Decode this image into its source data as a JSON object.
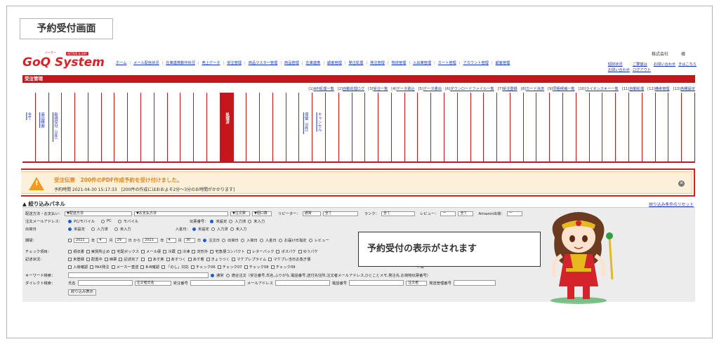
{
  "section_title": "予約受付画面",
  "logo": {
    "sub": "ジーオー",
    "badge": "ACTIVE & SAY",
    "main": "GoQ System"
  },
  "company": "株式会社　　　様",
  "nav": [
    "ホーム",
    "メール配信状況",
    "在庫連携動作状況",
    "売上データ",
    "受注管理",
    "商品マスター管理",
    "商品管理",
    "在庫連携",
    "顧客管理",
    "発注処理",
    "発注管理",
    "物流管理",
    "入出庫管理",
    "カート管理",
    "アカウント管理",
    "顧客管理"
  ],
  "nav_right": [
    "個別状況",
    "ご要望は",
    "お問い合わせ",
    "きはこちら",
    "お問い合わせ",
    "ログアウト"
  ],
  "header_bar": "受注管理",
  "subnav": [
    {
      "num": "[1]",
      "label": "API処理一覧"
    },
    {
      "num": "[2]",
      "label": "自動処理ログ"
    },
    {
      "num": "[3]",
      "label": "受注一覧"
    },
    {
      "num": "[4]",
      "label": "データ取込"
    },
    {
      "num": "[5]",
      "label": "データ書出"
    },
    {
      "num": "[6]",
      "label": "ダウンロードファイル一覧"
    },
    {
      "num": "[7]",
      "label": "受注登録"
    },
    {
      "num": "[8]",
      "label": "カード決済"
    },
    {
      "num": "[9]",
      "label": "同梱候補一覧"
    },
    {
      "num": "[10]",
      "label": "ライセンスキー一覧"
    },
    {
      "num": "[11]",
      "label": "自動処理"
    },
    {
      "num": "[12]",
      "label": "備考管理"
    },
    {
      "num": "[13]",
      "label": "各種設定"
    }
  ],
  "status_cols": [
    "全て",
    "商品検索",
    "新規受付（0件）",
    "",
    "",
    "",
    "",
    "",
    "",
    "",
    "",
    "",
    "",
    "",
    "",
    "処理済",
    "",
    "",
    "",
    "",
    "",
    "保留（0件）",
    "キャンセル",
    "",
    "",
    "",
    "",
    "",
    "",
    "",
    "",
    "",
    "",
    "",
    "",
    "",
    "",
    "",
    "",
    "",
    "",
    "",
    "",
    "",
    "",
    "",
    "",
    "",
    "",
    "",
    ""
  ],
  "active_col": 15,
  "alert": {
    "title": "受注伝票　200件のPDF作成予約を受け付けました。",
    "time": "予約時間 2021-04-30 15:17:33　[200件の作成にはおおよそ2分～3分のお時間がかかります]",
    "close": "✕",
    "warn": "!"
  },
  "panel": {
    "title": "絞り込みパネル",
    "toggle": "▲",
    "reset": "絞り込み条件のリセット",
    "r1": {
      "label": "配送方法・お支払い：",
      "s1": "▼配送方法",
      "s2": "▼お支払方法",
      "s3": "▼注文数",
      "s4": "▼個口数",
      "l2": "リピーター：",
      "s5": "通常",
      "s6": "全て",
      "l3": "ランク：",
      "s7": "全て",
      "l4": "レビュー：",
      "s8": "ー",
      "s9": "全て",
      "l5": "Amazon出荷：",
      "s10": "ー"
    },
    "r2": {
      "label": "注文メールアドレス：",
      "o1": "PC/モバイル",
      "o2": "PC",
      "o3": "モバイル",
      "l2": "伝票番号：",
      "o4": "未設定",
      "o5": "入力済",
      "o6": "未入力"
    },
    "r3": {
      "label": "出荷日",
      "o1": "未設定",
      "o2": "入力済",
      "o3": "未入力",
      "l2": "入金日：",
      "o4": "未設定",
      "o5": "入力済",
      "o6": "未入力"
    },
    "r4": {
      "label": "期間：",
      "y1": "2021",
      "m1": "4",
      "d1": "29",
      "from": "日 から",
      "y2": "2021",
      "m2": "4",
      "d2": "30",
      "o1": "注文日",
      "o2": "出荷日",
      "o3": "入荷日",
      "o4": "入金日",
      "o5": "お届け日指定",
      "o6": "レビュー"
    },
    "r5": {
      "label": "チェック項目：",
      "items": [
        "領収書",
        "実質所止め",
        "宅配ボックス",
        "メール便",
        "冷蔵",
        "冷凍",
        "定形外",
        "宅急便コンパクト",
        "レターパック",
        "ポスパケ",
        "ゆうパケ"
      ]
    },
    "r6": {
      "label": "記述状況：",
      "items": [
        "未登録",
        "配置中",
        "締票",
        "記述完了",
        "",
        "あす楽",
        "あすつく",
        "あす着",
        "きょうつく",
        "マケプレプライム",
        "マケプレ当日お急ぎ便"
      ]
    },
    "r7": {
      "items": [
        "入荷確認",
        "FAX発注",
        "メーカー直送",
        "B-B確認",
        "「のし」対応",
        "チェック06",
        "チェック07",
        "チェック08",
        "チェック09"
      ],
      "extra": "アム"
    },
    "r8": {
      "label": "キーワード検索：",
      "o1": "通常",
      "o2": "適合注文（受注番号,氏名,ふりがな,電話番号,送付先住所,注文者メールアドレス,ひとことメモ,発注先,お荷物伝票番号）"
    },
    "r9": {
      "label": "ダイレクト検索：",
      "l1": "氏名",
      "s1": "注文者氏名",
      "l2": "受注番号",
      "l3": "メールアドレス",
      "l4": "電話番号",
      "s2": "注文者",
      "l5": "発送管理番号"
    },
    "button": "絞り込み表示"
  },
  "callout": "予約受付の表示がされます",
  "colors": {
    "brand": "#c4161c",
    "link": "#1a35b3",
    "alert_border": "#e01b1b",
    "alert_bg": "#fdf0d8",
    "alert_title": "#e5841b",
    "warn": "#f29a1d"
  },
  "icons": {
    "warn": "warning-triangle-icon",
    "close": "close-circle-icon",
    "toggle": "caret-up-icon"
  }
}
